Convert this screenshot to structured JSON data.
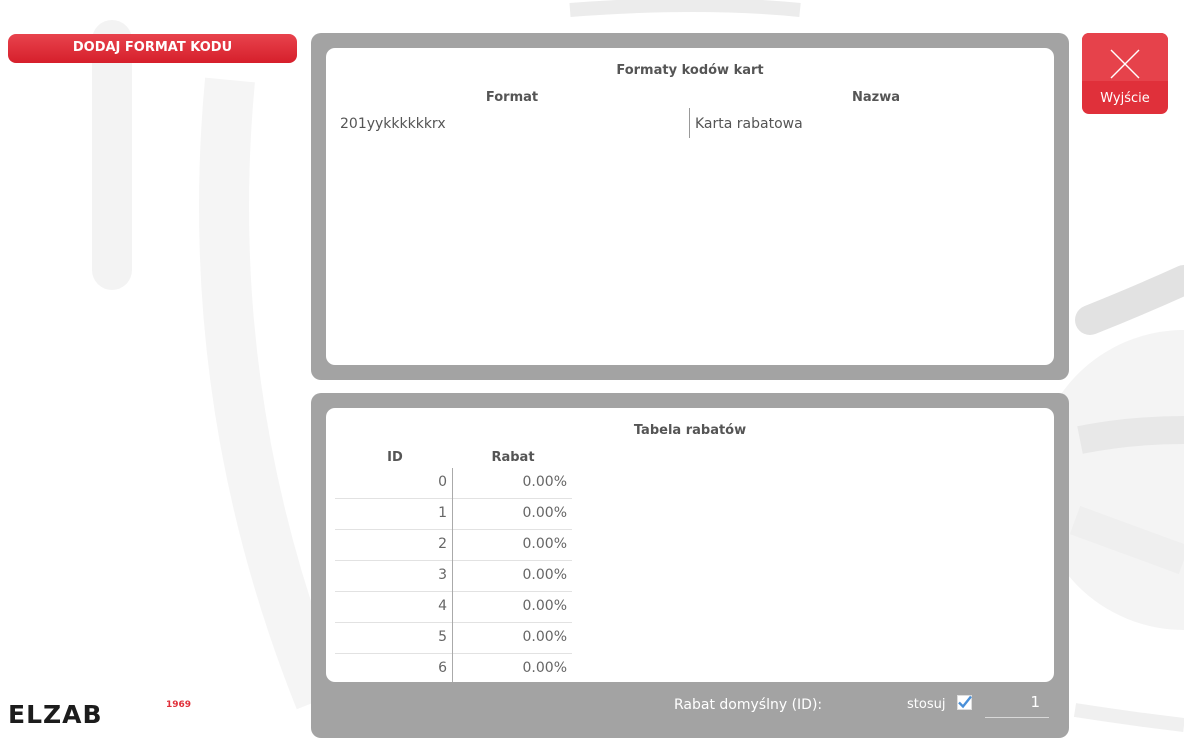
{
  "toolbar": {
    "add_format_label": "DODAJ FORMAT KODU"
  },
  "exit": {
    "label": "Wyjście",
    "icon": "close-icon"
  },
  "formats_panel": {
    "title": "Formaty kodów kart",
    "columns": [
      "Format",
      "Nazwa"
    ],
    "rows": [
      {
        "format": "201yykkkkkkrx",
        "name": "Karta rabatowa"
      }
    ]
  },
  "discount_panel": {
    "title": "Tabela rabatów",
    "columns": [
      "ID",
      "Rabat"
    ],
    "rows": [
      {
        "id": "0",
        "rabat": "0.00%"
      },
      {
        "id": "1",
        "rabat": "0.00%"
      },
      {
        "id": "2",
        "rabat": "0.00%"
      },
      {
        "id": "3",
        "rabat": "0.00%"
      },
      {
        "id": "4",
        "rabat": "0.00%"
      },
      {
        "id": "5",
        "rabat": "0.00%"
      },
      {
        "id": "6",
        "rabat": "0.00%"
      }
    ],
    "default_label": "Rabat domyślny (ID):",
    "apply_label": "stosuj",
    "apply_checked": true,
    "default_id": "1"
  },
  "brand": {
    "name": "ELZAB",
    "year": "1969"
  },
  "colors": {
    "accent": "#e0303a",
    "panel": "#a3a3a3",
    "checkbox": "#4a90d9"
  }
}
